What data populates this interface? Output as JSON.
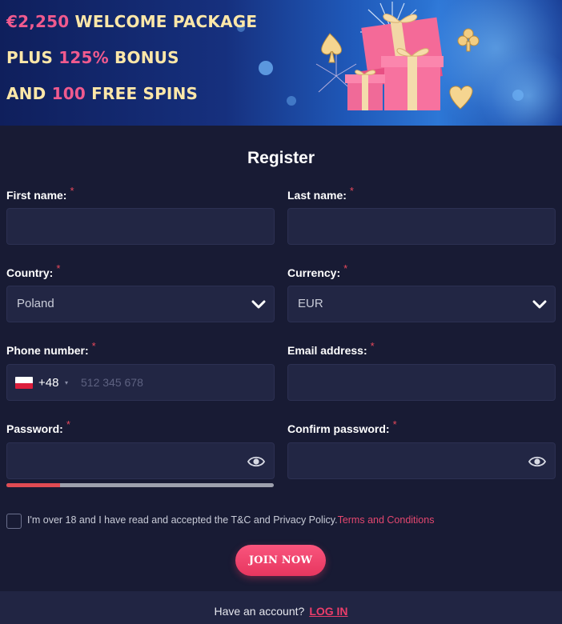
{
  "banner": {
    "line1_accent": "€2,250",
    "line1_text": " WELCOME PACKAGE",
    "line2_text": "PLUS ",
    "line2_accent": "125%",
    "line2_tail": " BONUS",
    "line3_text": "AND ",
    "line3_accent": "100",
    "line3_tail": " FREE SPINS"
  },
  "form": {
    "title": "Register",
    "required_mark": "*",
    "first_name": {
      "label": "First name:",
      "value": ""
    },
    "last_name": {
      "label": "Last name:",
      "value": ""
    },
    "country": {
      "label": "Country:",
      "value": "Poland",
      "icon": "chevron-down-icon"
    },
    "currency": {
      "label": "Currency:",
      "value": "EUR",
      "icon": "chevron-down-icon"
    },
    "phone": {
      "label": "Phone number:",
      "flag": "poland-flag-icon",
      "dial_code": "+48",
      "caret": "▾",
      "placeholder": "512 345 678"
    },
    "email": {
      "label": "Email address:",
      "value": ""
    },
    "password": {
      "label": "Password:",
      "value": "",
      "icon": "eye-icon",
      "strength": 0.2
    },
    "confirm_password": {
      "label": "Confirm password:",
      "value": "",
      "icon": "eye-icon"
    },
    "consent": {
      "text": "I'm over 18 and I have read and accepted the T&C and Privacy Policy.",
      "link": "Terms and Conditions",
      "checked": false
    },
    "join_button": "JOIN NOW"
  },
  "footer": {
    "text": "Have an account?",
    "link": "LOG IN"
  },
  "colors": {
    "background": "#181b34",
    "field": "#222644",
    "accent_pink": "#f05a8e",
    "banner_text": "#fde7a8",
    "required": "#e8485b",
    "strength_weak": "#e04b53",
    "link": "#ec3d6a"
  }
}
